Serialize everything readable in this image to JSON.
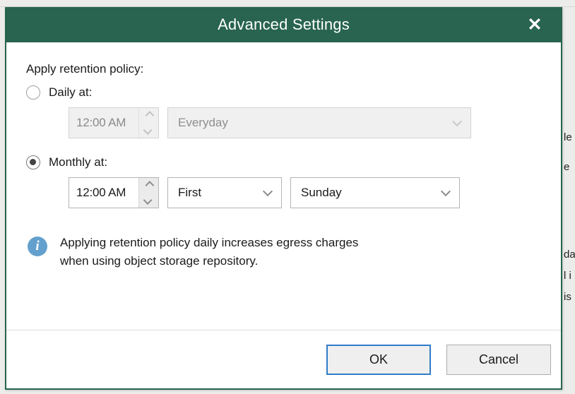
{
  "background": {
    "right_column_fragments": [
      "le",
      "e",
      "da",
      "l i",
      "is"
    ]
  },
  "dialog": {
    "title": "Advanced Settings",
    "close_icon": "close-icon",
    "section_label": "Apply retention policy:",
    "options": [
      {
        "id": "daily",
        "label": "Daily at:",
        "selected": false,
        "enabled": false,
        "time_value": "12:00 AM",
        "schedule_value": "Everyday"
      },
      {
        "id": "monthly",
        "label": "Monthly at:",
        "selected": true,
        "enabled": true,
        "time_value": "12:00 AM",
        "week_value": "First",
        "day_value": "Sunday"
      }
    ],
    "info": {
      "icon": "info-icon",
      "line1": "Applying retention policy daily increases egress charges",
      "line2": "when using object storage repository."
    },
    "footer": {
      "ok_label": "OK",
      "cancel_label": "Cancel"
    }
  },
  "colors": {
    "titlebar": "#28644f",
    "accent_focus": "#2f7cc9",
    "info_icon": "#64a0cd"
  }
}
